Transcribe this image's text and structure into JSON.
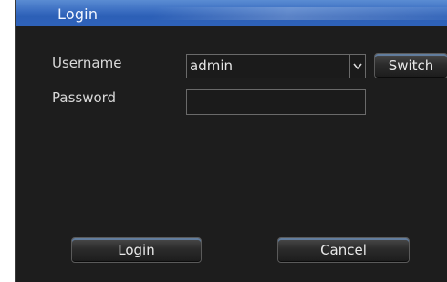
{
  "window": {
    "title": "Login"
  },
  "form": {
    "username_label": "Username",
    "username_value": "admin",
    "password_label": "Password",
    "password_value": ""
  },
  "buttons": {
    "switch_label": "Switch",
    "login_label": "Login",
    "cancel_label": "Cancel"
  },
  "icons": {
    "dropdown": "chevron-down-icon"
  },
  "colors": {
    "titlebar": "#3f72c4",
    "background": "#1d1d1d",
    "accent": "#5a8cd3"
  }
}
